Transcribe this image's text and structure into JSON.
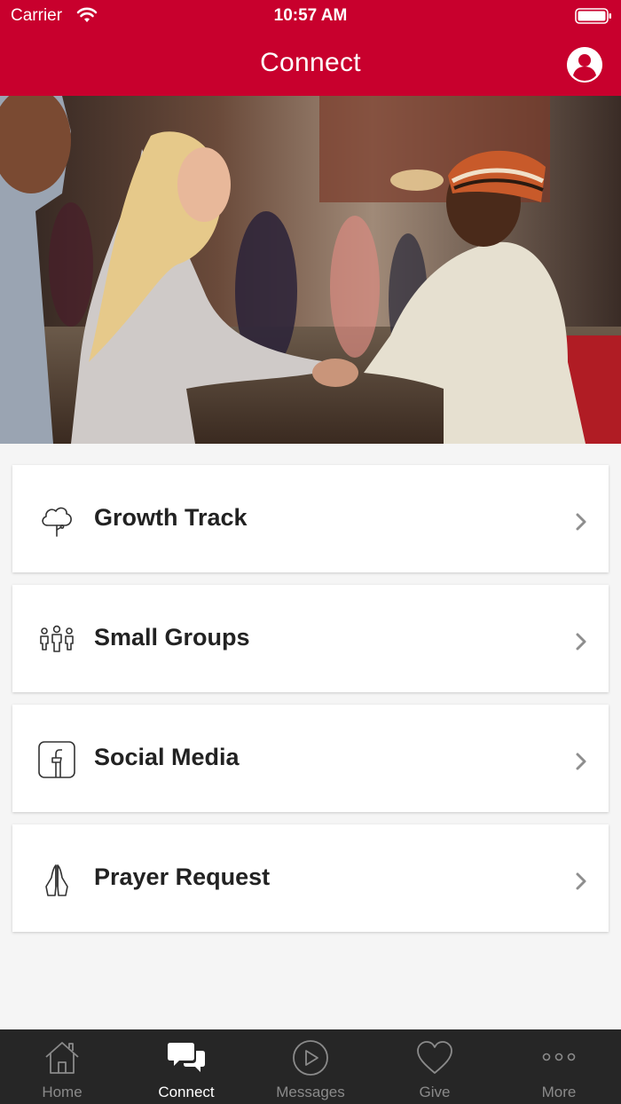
{
  "status_bar": {
    "carrier": "Carrier",
    "time": "10:57 AM"
  },
  "nav": {
    "title": "Connect"
  },
  "colors": {
    "brand": "#c8002d",
    "tabbar": "#262626",
    "tab_inactive": "#8a8a8a",
    "tab_active": "#ffffff"
  },
  "menu": {
    "items": [
      {
        "label": "Growth Track",
        "icon": "tree-icon"
      },
      {
        "label": "Small Groups",
        "icon": "people-group-icon"
      },
      {
        "label": "Social Media",
        "icon": "facebook-icon"
      },
      {
        "label": "Prayer Request",
        "icon": "praying-hands-icon"
      }
    ]
  },
  "tabbar": {
    "tabs": [
      {
        "label": "Home",
        "icon": "house-icon",
        "active": false
      },
      {
        "label": "Connect",
        "icon": "chat-bubbles-icon",
        "active": true
      },
      {
        "label": "Messages",
        "icon": "play-circle-icon",
        "active": false
      },
      {
        "label": "Give",
        "icon": "heart-icon",
        "active": false
      },
      {
        "label": "More",
        "icon": "more-dots-icon",
        "active": false
      }
    ]
  }
}
